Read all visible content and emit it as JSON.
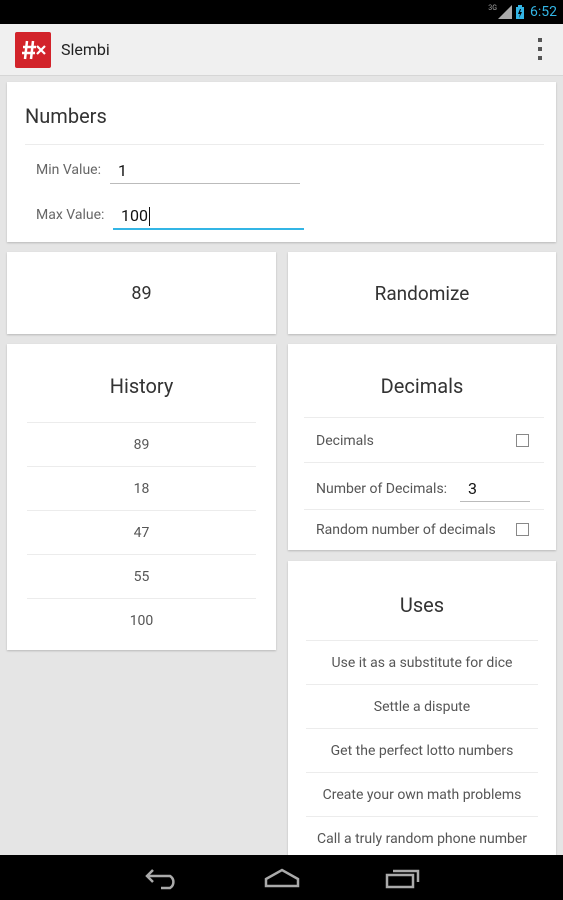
{
  "status_bar": {
    "network": "3G",
    "time": "6:52"
  },
  "app_bar": {
    "title": "Slembi"
  },
  "numbers": {
    "heading": "Numbers",
    "min_label": "Min Value:",
    "min_value": "1",
    "max_label": "Max Value:",
    "max_value": "100"
  },
  "result": {
    "value": "89"
  },
  "randomize": {
    "label": "Randomize"
  },
  "history": {
    "heading": "History",
    "items": [
      "89",
      "18",
      "47",
      "55",
      "100"
    ]
  },
  "decimals": {
    "heading": "Decimals",
    "decimals_label": "Decimals",
    "decimals_checked": false,
    "num_label": "Number of Decimals:",
    "num_value": "3",
    "random_label": "Random number of decimals",
    "random_checked": false
  },
  "uses": {
    "heading": "Uses",
    "items": [
      "Use it as a substitute for dice",
      "Settle a dispute",
      "Get the perfect lotto numbers",
      "Create your own math problems",
      "Call a truly random phone number"
    ]
  },
  "colors": {
    "accent": "#33b5e5",
    "brand": "#d2232a"
  }
}
